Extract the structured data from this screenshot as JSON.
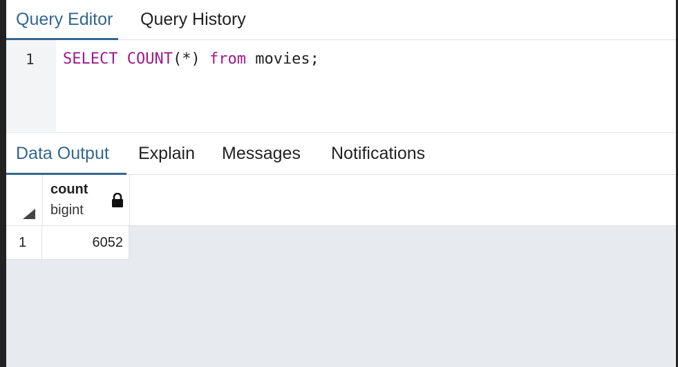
{
  "top_tabs": {
    "query_editor": "Query Editor",
    "query_history": "Query History",
    "active": "query_editor"
  },
  "editor": {
    "line_number": "1",
    "tokens": {
      "select": "SELECT",
      "count_fn": "COUNT",
      "args": "(*)",
      "from": "from",
      "table": "movies;"
    }
  },
  "bottom_tabs": {
    "data_output": "Data Output",
    "explain": "Explain",
    "messages": "Messages",
    "notifications": "Notifications",
    "active": "data_output"
  },
  "grid": {
    "columns": [
      {
        "name": "count",
        "type": "bigint",
        "icon": "lock-icon"
      }
    ],
    "rows": [
      {
        "row_number": "1",
        "values": [
          "6052"
        ]
      }
    ]
  },
  "colors": {
    "accent": "#326690",
    "keyword": "#9c1a8c",
    "grid_background": "#e7eaee",
    "gutter_background": "#f3f4f6"
  }
}
